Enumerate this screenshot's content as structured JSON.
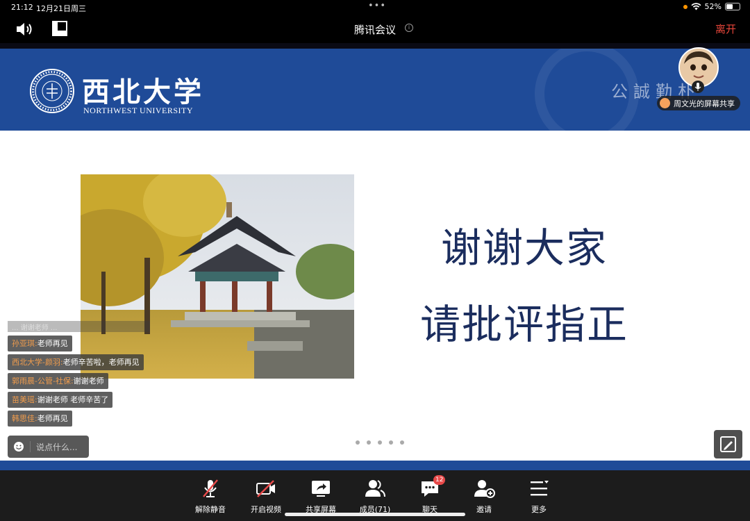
{
  "status_bar": {
    "time": "21:12",
    "date": "12月21日周三",
    "multitask_dots": "•••",
    "battery_percent": "52%",
    "battery_level": 0.52
  },
  "title_bar": {
    "title": "腾讯会议",
    "leave_label": "离开"
  },
  "slide": {
    "university_name_cn": "西北大学",
    "university_name_en": "NORTHWEST UNIVERSITY",
    "motto": "公誠勤朴",
    "heading_line1": "谢谢大家",
    "heading_line2": "请批评指正",
    "page_count": 5
  },
  "presenter": {
    "share_label": "周文光的屏幕共享"
  },
  "chat": {
    "faded_text": "... 谢谢老师 ...",
    "messages": [
      {
        "sender": "孙亚琪:",
        "text": "老师再见"
      },
      {
        "sender": "西北大学-颜羽:",
        "text": "老师辛苦啦，老师再见"
      },
      {
        "sender": "郭雨晨-公管-社保:",
        "text": "谢谢老师"
      },
      {
        "sender": "苗美瑶:",
        "text": "谢谢老师 老师辛苦了"
      },
      {
        "sender": "韩思佳:",
        "text": "老师再见"
      }
    ],
    "input_placeholder": "说点什么..."
  },
  "toolbar": {
    "unmute_label": "解除静音",
    "video_label": "开启视频",
    "share_label": "共享屏幕",
    "members_label": "成员(71)",
    "chat_label": "聊天",
    "chat_badge": "12",
    "invite_label": "邀请",
    "more_label": "更多"
  },
  "colors": {
    "brand_blue": "#1f4b98",
    "leave_red": "#e8463a",
    "sender_orange": "#f29d4d",
    "heading_navy": "#1b2d5e"
  },
  "icons": {
    "speaker": "speaker-icon",
    "layout": "layout-icon",
    "info": "info-icon",
    "mic_muted": "mic-muted-icon",
    "video_off": "video-off-icon",
    "share_screen": "share-screen-icon",
    "members": "members-icon",
    "chat": "chat-icon",
    "invite": "invite-icon",
    "more": "more-icon",
    "annotate": "annotate-icon",
    "emoji": "emoji-icon"
  }
}
